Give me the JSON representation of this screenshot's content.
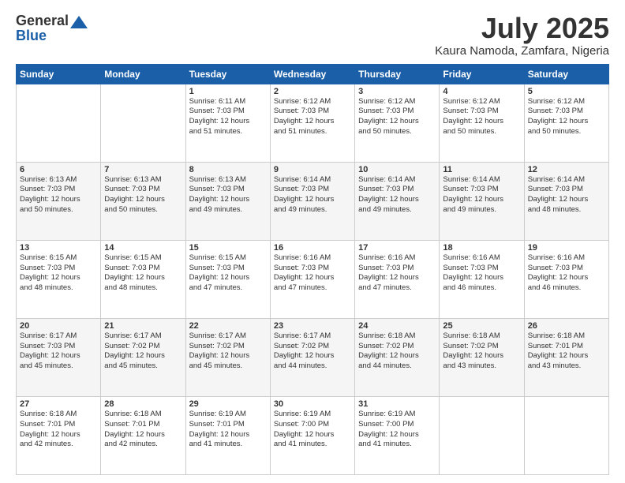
{
  "logo": {
    "general": "General",
    "blue": "Blue"
  },
  "title": "July 2025",
  "location": "Kaura Namoda, Zamfara, Nigeria",
  "days_header": [
    "Sunday",
    "Monday",
    "Tuesday",
    "Wednesday",
    "Thursday",
    "Friday",
    "Saturday"
  ],
  "weeks": [
    [
      {
        "day": "",
        "info": ""
      },
      {
        "day": "",
        "info": ""
      },
      {
        "day": "1",
        "info": "Sunrise: 6:11 AM\nSunset: 7:03 PM\nDaylight: 12 hours\nand 51 minutes."
      },
      {
        "day": "2",
        "info": "Sunrise: 6:12 AM\nSunset: 7:03 PM\nDaylight: 12 hours\nand 51 minutes."
      },
      {
        "day": "3",
        "info": "Sunrise: 6:12 AM\nSunset: 7:03 PM\nDaylight: 12 hours\nand 50 minutes."
      },
      {
        "day": "4",
        "info": "Sunrise: 6:12 AM\nSunset: 7:03 PM\nDaylight: 12 hours\nand 50 minutes."
      },
      {
        "day": "5",
        "info": "Sunrise: 6:12 AM\nSunset: 7:03 PM\nDaylight: 12 hours\nand 50 minutes."
      }
    ],
    [
      {
        "day": "6",
        "info": "Sunrise: 6:13 AM\nSunset: 7:03 PM\nDaylight: 12 hours\nand 50 minutes."
      },
      {
        "day": "7",
        "info": "Sunrise: 6:13 AM\nSunset: 7:03 PM\nDaylight: 12 hours\nand 50 minutes."
      },
      {
        "day": "8",
        "info": "Sunrise: 6:13 AM\nSunset: 7:03 PM\nDaylight: 12 hours\nand 49 minutes."
      },
      {
        "day": "9",
        "info": "Sunrise: 6:14 AM\nSunset: 7:03 PM\nDaylight: 12 hours\nand 49 minutes."
      },
      {
        "day": "10",
        "info": "Sunrise: 6:14 AM\nSunset: 7:03 PM\nDaylight: 12 hours\nand 49 minutes."
      },
      {
        "day": "11",
        "info": "Sunrise: 6:14 AM\nSunset: 7:03 PM\nDaylight: 12 hours\nand 49 minutes."
      },
      {
        "day": "12",
        "info": "Sunrise: 6:14 AM\nSunset: 7:03 PM\nDaylight: 12 hours\nand 48 minutes."
      }
    ],
    [
      {
        "day": "13",
        "info": "Sunrise: 6:15 AM\nSunset: 7:03 PM\nDaylight: 12 hours\nand 48 minutes."
      },
      {
        "day": "14",
        "info": "Sunrise: 6:15 AM\nSunset: 7:03 PM\nDaylight: 12 hours\nand 48 minutes."
      },
      {
        "day": "15",
        "info": "Sunrise: 6:15 AM\nSunset: 7:03 PM\nDaylight: 12 hours\nand 47 minutes."
      },
      {
        "day": "16",
        "info": "Sunrise: 6:16 AM\nSunset: 7:03 PM\nDaylight: 12 hours\nand 47 minutes."
      },
      {
        "day": "17",
        "info": "Sunrise: 6:16 AM\nSunset: 7:03 PM\nDaylight: 12 hours\nand 47 minutes."
      },
      {
        "day": "18",
        "info": "Sunrise: 6:16 AM\nSunset: 7:03 PM\nDaylight: 12 hours\nand 46 minutes."
      },
      {
        "day": "19",
        "info": "Sunrise: 6:16 AM\nSunset: 7:03 PM\nDaylight: 12 hours\nand 46 minutes."
      }
    ],
    [
      {
        "day": "20",
        "info": "Sunrise: 6:17 AM\nSunset: 7:03 PM\nDaylight: 12 hours\nand 45 minutes."
      },
      {
        "day": "21",
        "info": "Sunrise: 6:17 AM\nSunset: 7:02 PM\nDaylight: 12 hours\nand 45 minutes."
      },
      {
        "day": "22",
        "info": "Sunrise: 6:17 AM\nSunset: 7:02 PM\nDaylight: 12 hours\nand 45 minutes."
      },
      {
        "day": "23",
        "info": "Sunrise: 6:17 AM\nSunset: 7:02 PM\nDaylight: 12 hours\nand 44 minutes."
      },
      {
        "day": "24",
        "info": "Sunrise: 6:18 AM\nSunset: 7:02 PM\nDaylight: 12 hours\nand 44 minutes."
      },
      {
        "day": "25",
        "info": "Sunrise: 6:18 AM\nSunset: 7:02 PM\nDaylight: 12 hours\nand 43 minutes."
      },
      {
        "day": "26",
        "info": "Sunrise: 6:18 AM\nSunset: 7:01 PM\nDaylight: 12 hours\nand 43 minutes."
      }
    ],
    [
      {
        "day": "27",
        "info": "Sunrise: 6:18 AM\nSunset: 7:01 PM\nDaylight: 12 hours\nand 42 minutes."
      },
      {
        "day": "28",
        "info": "Sunrise: 6:18 AM\nSunset: 7:01 PM\nDaylight: 12 hours\nand 42 minutes."
      },
      {
        "day": "29",
        "info": "Sunrise: 6:19 AM\nSunset: 7:01 PM\nDaylight: 12 hours\nand 41 minutes."
      },
      {
        "day": "30",
        "info": "Sunrise: 6:19 AM\nSunset: 7:00 PM\nDaylight: 12 hours\nand 41 minutes."
      },
      {
        "day": "31",
        "info": "Sunrise: 6:19 AM\nSunset: 7:00 PM\nDaylight: 12 hours\nand 41 minutes."
      },
      {
        "day": "",
        "info": ""
      },
      {
        "day": "",
        "info": ""
      }
    ]
  ]
}
